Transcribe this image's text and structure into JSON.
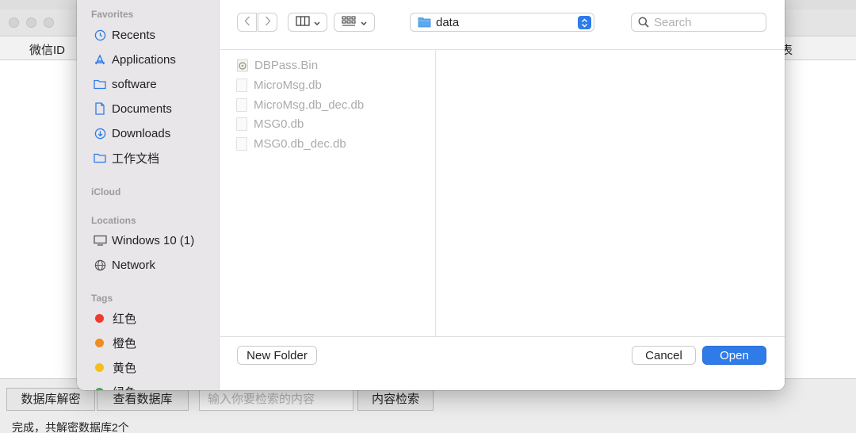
{
  "background_app": {
    "columns": [
      "微信ID",
      "表"
    ],
    "buttons": {
      "decrypt": "数据库解密",
      "view": "查看数据库",
      "search": "内容检索"
    },
    "search_placeholder": "输入你要检索的内容",
    "status": "完成，共解密数据库2个"
  },
  "dialog": {
    "sidebar": {
      "favorites_label": "Favorites",
      "favorites": [
        {
          "label": "Recents",
          "icon": "clock-icon"
        },
        {
          "label": "Applications",
          "icon": "applications-icon"
        },
        {
          "label": "software",
          "icon": "folder-icon"
        },
        {
          "label": "Documents",
          "icon": "document-icon"
        },
        {
          "label": "Downloads",
          "icon": "download-icon"
        },
        {
          "label": "工作文档",
          "icon": "folder-icon"
        }
      ],
      "icloud_label": "iCloud",
      "locations_label": "Locations",
      "locations": [
        {
          "label": "Windows 10 (1)",
          "icon": "display-icon"
        },
        {
          "label": "Network",
          "icon": "globe-icon"
        }
      ],
      "tags_label": "Tags",
      "tags": [
        {
          "label": "红色",
          "color": "#ee3b30"
        },
        {
          "label": "橙色",
          "color": "#f18a20"
        },
        {
          "label": "黄色",
          "color": "#f5c016"
        },
        {
          "label": "绿色",
          "color": "#2fb84b"
        }
      ]
    },
    "toolbar": {
      "path": "data",
      "search_placeholder": "Search"
    },
    "files": [
      {
        "name": "DBPass.Bin",
        "kind": "exec"
      },
      {
        "name": "MicroMsg.db",
        "kind": "doc"
      },
      {
        "name": "MicroMsg.db_dec.db",
        "kind": "doc"
      },
      {
        "name": "MSG0.db",
        "kind": "doc"
      },
      {
        "name": "MSG0.db_dec.db",
        "kind": "doc"
      }
    ],
    "buttons": {
      "new_folder": "New Folder",
      "cancel": "Cancel",
      "open": "Open"
    }
  }
}
